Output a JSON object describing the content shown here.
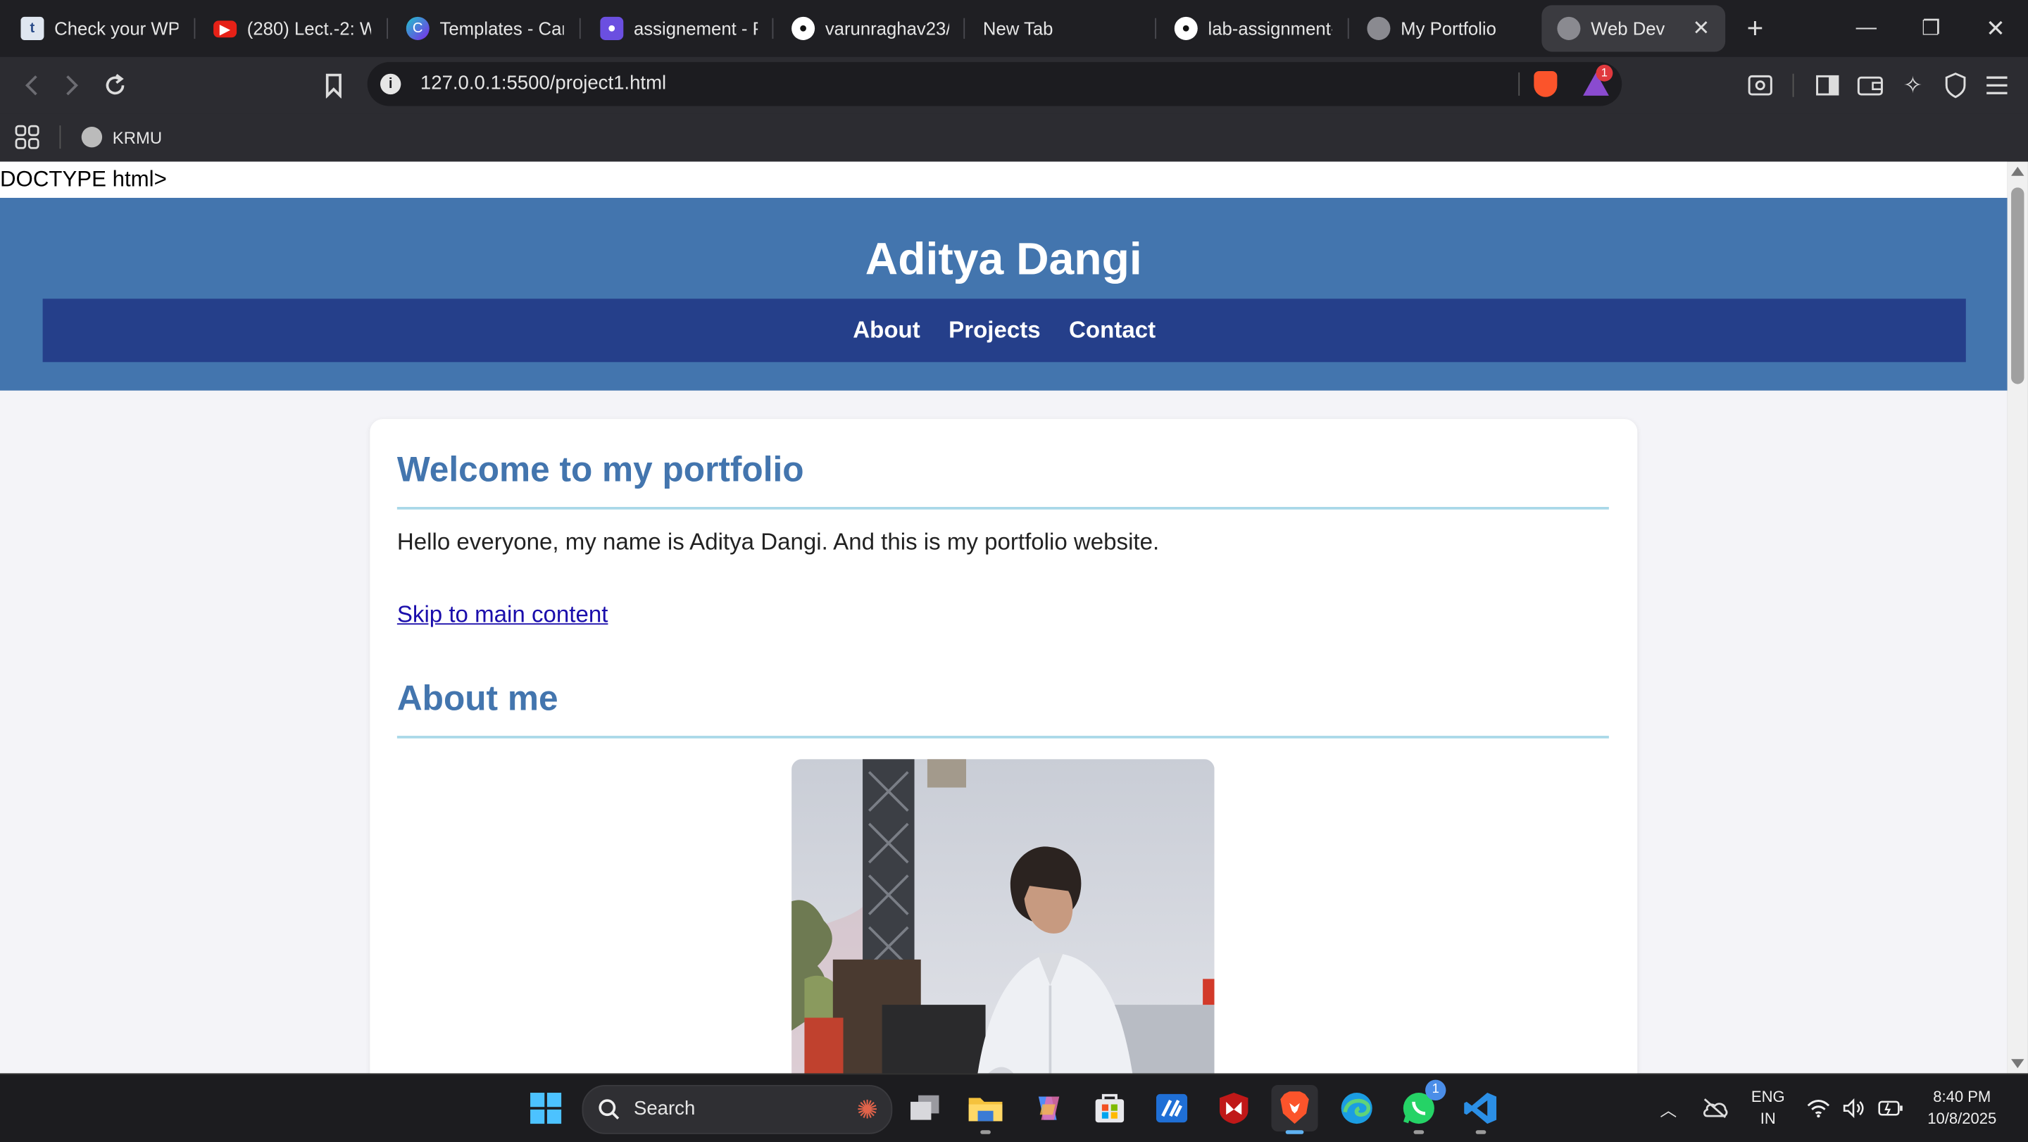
{
  "browser": {
    "tabs": [
      {
        "title": "Check your WPM",
        "icon": "t-icon"
      },
      {
        "title": "(280) Lect.-2: Wa",
        "icon": "youtube-icon"
      },
      {
        "title": "Templates - Canv",
        "icon": "canva-icon"
      },
      {
        "title": "assignement - P",
        "icon": "app-icon"
      },
      {
        "title": "varunraghav23/l",
        "icon": "github-icon"
      },
      {
        "title": "New Tab",
        "icon": ""
      },
      {
        "title": "lab-assignment-",
        "icon": "github-icon"
      },
      {
        "title": "My Portfolio",
        "icon": "globe-icon"
      },
      {
        "title": "Web Dev",
        "icon": "globe-icon"
      }
    ],
    "url": "127.0.0.1:5500/project1.html",
    "notification_count": "1",
    "bookmarks": [
      {
        "label": "KRMU"
      }
    ]
  },
  "page": {
    "doctype_text": "DOCTYPE html>",
    "site_title": "Aditya Dangi",
    "nav": [
      "About",
      "Projects",
      "Contact"
    ],
    "welcome_heading": "Welcome to my portfolio",
    "intro_text": "Hello everyone, my name is Aditya Dangi. And this is my portfolio website.",
    "skip_link": "Skip to main content",
    "about_heading": "About me"
  },
  "taskbar": {
    "search_label": "Search",
    "whatsapp_badge": "1",
    "language": "ENG",
    "region": "IN",
    "time": "8:40 PM",
    "date": "10/8/2025"
  },
  "colors": {
    "header_bg": "#4375ae",
    "nav_bg": "#253f8a",
    "heading": "#4375ae",
    "rule": "#a9d8e8"
  }
}
